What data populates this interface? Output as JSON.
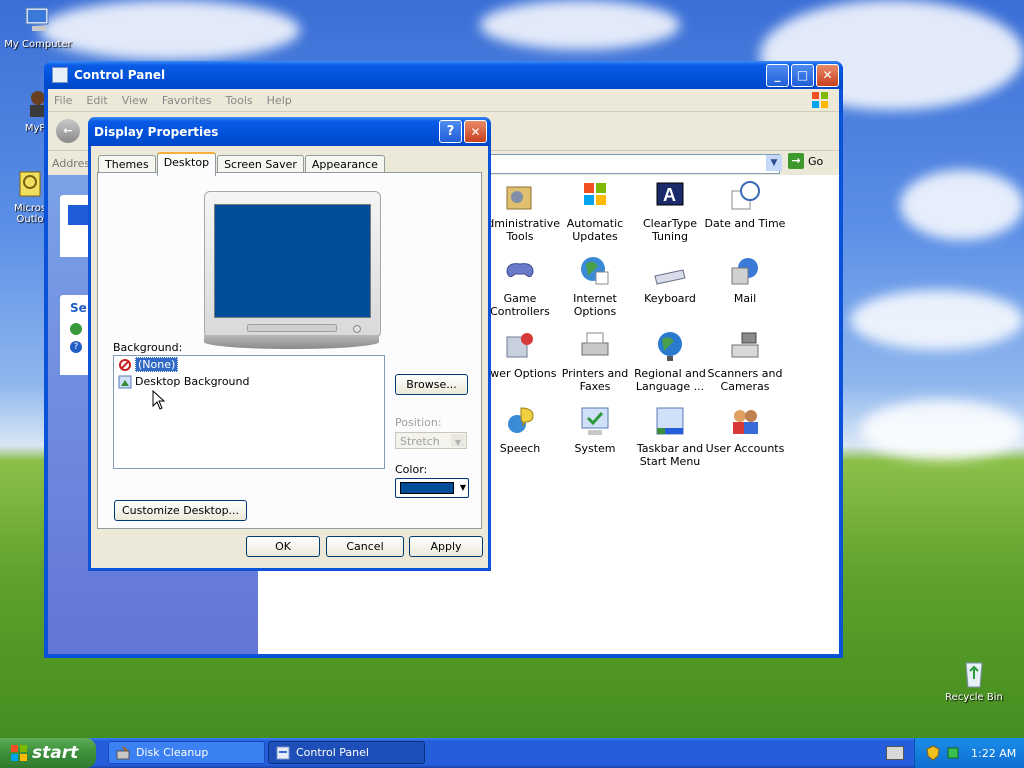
{
  "desktop": {
    "icons": [
      {
        "label": "My Computer"
      },
      {
        "label": "MyPa"
      },
      {
        "label": "Micros Outlo"
      },
      {
        "label": "Recycle Bin"
      }
    ]
  },
  "control_panel": {
    "title": "Control Panel",
    "menu": [
      "File",
      "Edit",
      "View",
      "Favorites",
      "Tools",
      "Help"
    ],
    "address_label": "Addres",
    "go_label": "Go",
    "left_pane_header": "Se",
    "items": [
      {
        "label": "Administrative Tools",
        "icon": "admin-tools-icon"
      },
      {
        "label": "Automatic Updates",
        "icon": "automatic-updates-icon"
      },
      {
        "label": "ClearType Tuning",
        "icon": "cleartype-icon"
      },
      {
        "label": "Date and Time",
        "icon": "date-time-icon"
      },
      {
        "label": "Game Controllers",
        "icon": "game-controller-icon"
      },
      {
        "label": "Internet Options",
        "icon": "internet-options-icon"
      },
      {
        "label": "Keyboard",
        "icon": "keyboard-icon"
      },
      {
        "label": "Mail",
        "icon": "mail-icon"
      },
      {
        "label": "ower Options",
        "icon": "power-options-icon"
      },
      {
        "label": "Printers and Faxes",
        "icon": "printers-icon"
      },
      {
        "label": "Regional and Language ...",
        "icon": "regional-icon"
      },
      {
        "label": "Scanners and Cameras",
        "icon": "scanners-icon"
      },
      {
        "label": "Speech",
        "icon": "speech-icon"
      },
      {
        "label": "System",
        "icon": "system-icon"
      },
      {
        "label": "Taskbar and Start Menu",
        "icon": "taskbar-icon"
      },
      {
        "label": "User Accounts",
        "icon": "user-accounts-icon"
      }
    ]
  },
  "dialog": {
    "title": "Display Properties",
    "help": "?",
    "tabs": [
      "Themes",
      "Desktop",
      "Screen Saver",
      "Appearance"
    ],
    "active_tab": "Desktop",
    "background_label": "Background:",
    "background_items": [
      {
        "label": "(None)",
        "selected": true
      },
      {
        "label": "Desktop Background",
        "selected": false
      }
    ],
    "browse_label": "Browse...",
    "position_label": "Position:",
    "position_value": "Stretch",
    "color_label": "Color:",
    "color_value": "#004e98",
    "customize_label": "Customize Desktop...",
    "ok_label": "OK",
    "cancel_label": "Cancel",
    "apply_label": "Apply"
  },
  "taskbar": {
    "start_label": "start",
    "items": [
      {
        "label": "Disk Cleanup",
        "active": false
      },
      {
        "label": "Control Panel",
        "active": true
      }
    ],
    "clock": "1:22 AM"
  }
}
